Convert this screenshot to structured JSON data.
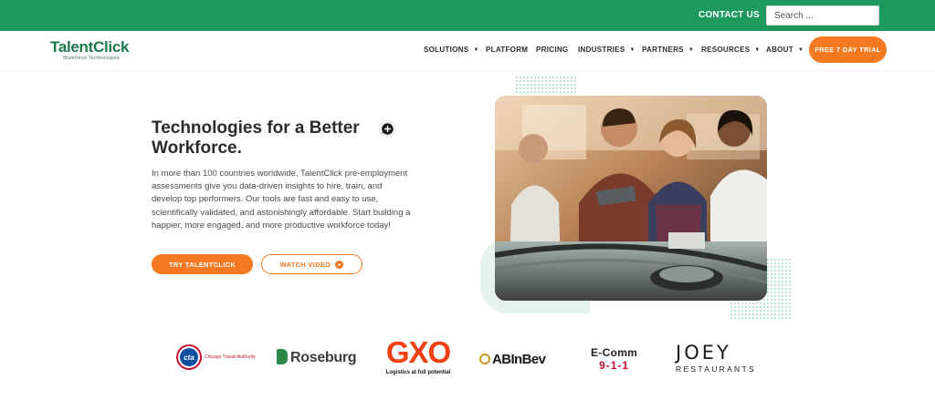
{
  "topbar": {
    "contact_label": "CONTACT US",
    "search_placeholder": "Search ..."
  },
  "brand": {
    "name": "TalentClick",
    "tagline": "Workforce Technologies",
    "primary_color": "#1f9a5f",
    "accent_color": "#f47920"
  },
  "nav": {
    "items": [
      {
        "label": "SOLUTIONS",
        "has_dropdown": true
      },
      {
        "label": "PLATFORM",
        "has_dropdown": false
      },
      {
        "label": "PRICING",
        "has_dropdown": false
      },
      {
        "label": "INDUSTRIES",
        "has_dropdown": true
      },
      {
        "label": "PARTNERS",
        "has_dropdown": true
      },
      {
        "label": "RESOURCES",
        "has_dropdown": true
      },
      {
        "label": "ABOUT",
        "has_dropdown": true
      }
    ],
    "cta_label": "FREE 7 DAY TRIAL"
  },
  "hero": {
    "title": "Technologies for a Better Workforce.",
    "body": "In more than 100 countries worldwide, TalentClick pre-employment assessments give you data-driven insights to hire, train, and develop top performers. Our tools are fast and easy to use, scientifically validated, and astonishingly affordable. Start building a happier, more engaged, and more productive workforce today!",
    "primary_button": "TRY TALENTCLICK",
    "secondary_button": "WATCH VIDEO",
    "icon": "chat-bubble-icon",
    "photo_icon": "team-photo"
  },
  "client_logos": {
    "cta": {
      "mark": "cta",
      "text": "Chicago Transit Authority"
    },
    "roseburg": {
      "text": "Roseburg"
    },
    "gxo": {
      "text": "GXO",
      "tagline": "Logistics at full potential"
    },
    "abinbev": {
      "text": "ABInBev"
    },
    "ecomm": {
      "text": "E-Comm",
      "sub": "9-1-1"
    },
    "joey": {
      "text": "JOEY",
      "sub": "RESTAURANTS"
    }
  }
}
